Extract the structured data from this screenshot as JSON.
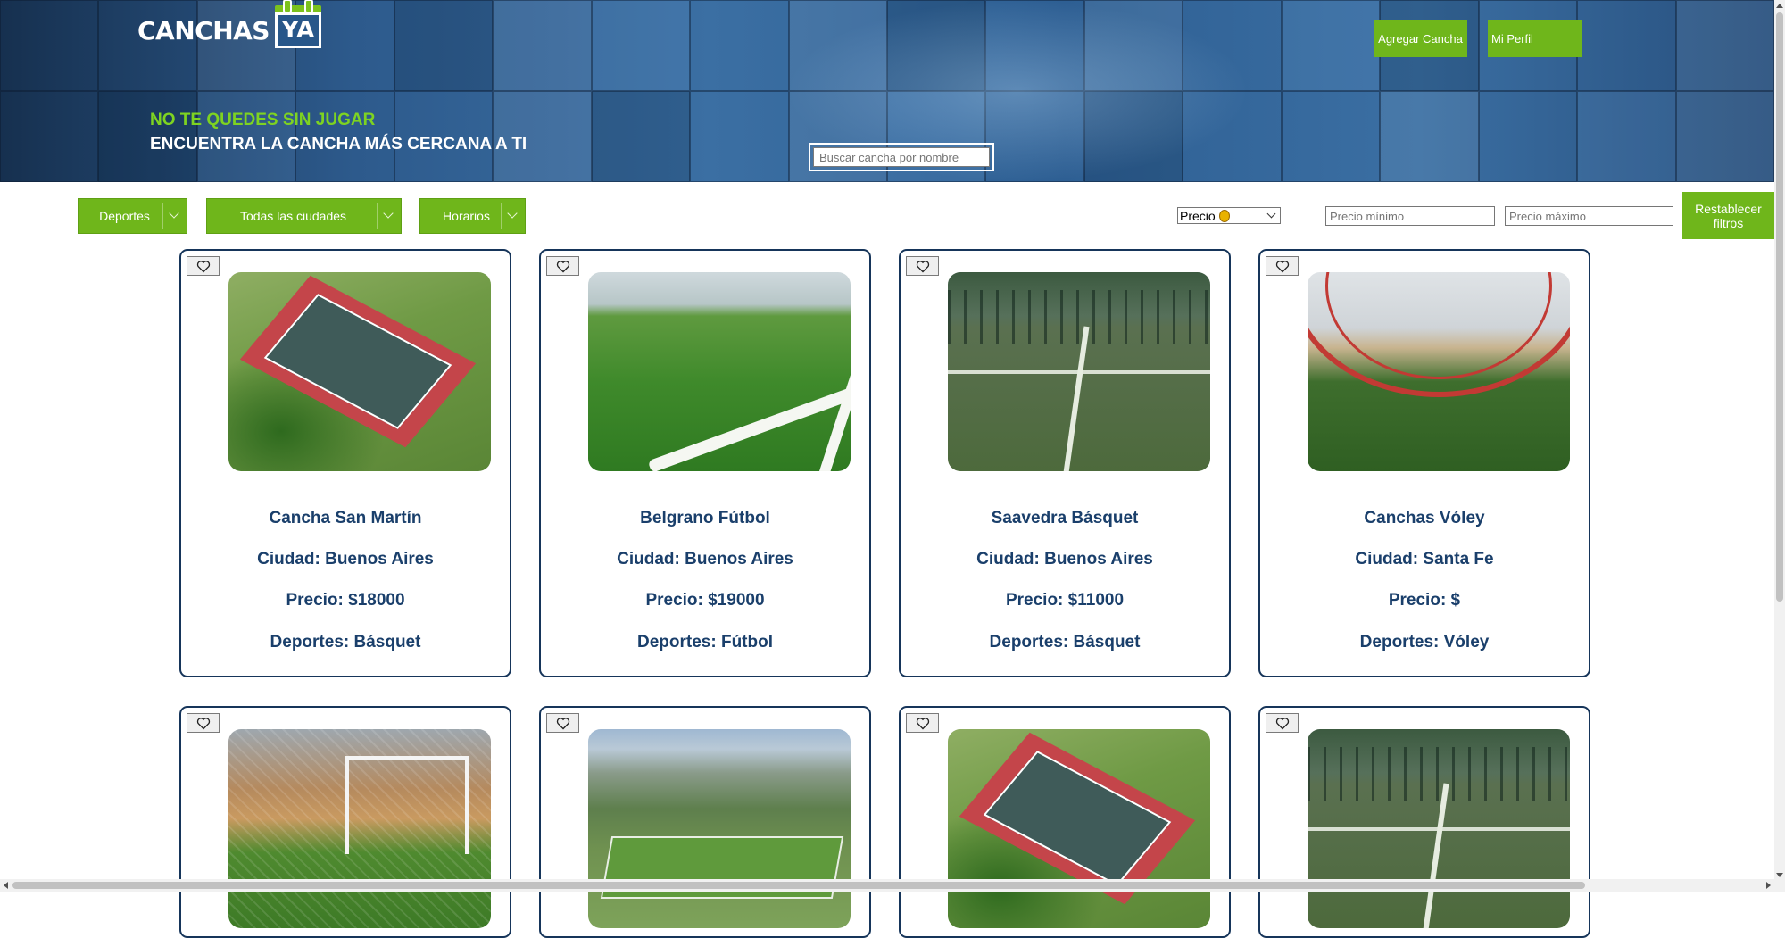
{
  "header": {
    "logo_text": "CANCHAS",
    "logo_badge": "YA",
    "tagline_1": "NO TE QUEDES SIN JUGAR",
    "tagline_2": "ENCUENTRA LA CANCHA MÁS CERCANA A TI",
    "search_placeholder": "Buscar cancha por nombre",
    "add_button": "Agregar Cancha",
    "profile_button": "Mi Perfil"
  },
  "filters": {
    "sports": "Deportes",
    "cities": "Todas las ciudades",
    "schedules": "Horarios",
    "sort_select": "Precio",
    "min_price_placeholder": "Precio mínimo",
    "max_price_placeholder": "Precio máximo",
    "reset_button": "Restablecer filtros"
  },
  "colors": {
    "accent_green": "#6fb61b",
    "tagline_green": "#7ed321",
    "card_border": "#16355a",
    "card_text": "#1a3f6b"
  },
  "cards": [
    {
      "name": "Cancha San Martín",
      "city": "Ciudad: Buenos Aires",
      "price": "Precio: $18000",
      "sports": "Deportes: Básquet",
      "photo": "basketball-court"
    },
    {
      "name": "Belgrano Fútbol",
      "city": "Ciudad: Buenos Aires",
      "price": "Precio: $19000",
      "sports": "Deportes: Fútbol",
      "photo": "turf-corner"
    },
    {
      "name": "Saavedra Básquet",
      "city": "Ciudad: Buenos Aires",
      "price": "Precio: $11000",
      "sports": "Deportes: Básquet",
      "photo": "fenced-turf"
    },
    {
      "name": "Canchas Vóley",
      "city": "Ciudad: Santa Fe",
      "price": "Precio: $",
      "sports": "Deportes: Vóley",
      "photo": "indoor-hall"
    },
    {
      "photo": "goal-turf"
    },
    {
      "photo": "hillside-field"
    },
    {
      "photo": "basketball-court"
    },
    {
      "photo": "fenced-turf"
    }
  ],
  "icons": {
    "favorite": "heart-icon",
    "dropdown": "chevron-down-icon",
    "price_sort": "money-bag-icon"
  }
}
